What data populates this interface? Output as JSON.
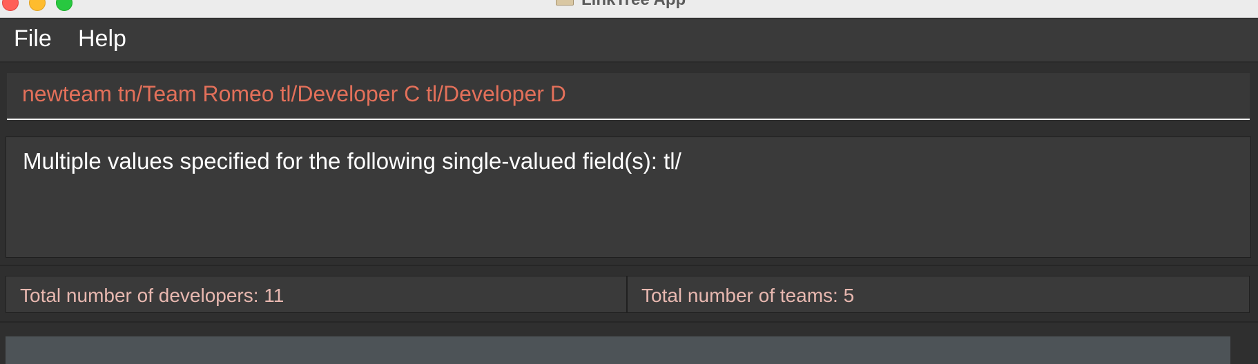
{
  "window": {
    "title": "LinkTree App"
  },
  "menu": {
    "file": "File",
    "help": "Help"
  },
  "command": {
    "value": "newteam tn/Team Romeo tl/Developer C tl/Developer D"
  },
  "result": {
    "message": "Multiple values specified for the following single-valued field(s): tl/"
  },
  "stats": {
    "developers": "Total number of developers: 11",
    "teams": "Total number of teams: 5"
  },
  "colors": {
    "command_text": "#e3705a",
    "stat_text": "#e8b8b0",
    "background": "#2f2f2f"
  }
}
